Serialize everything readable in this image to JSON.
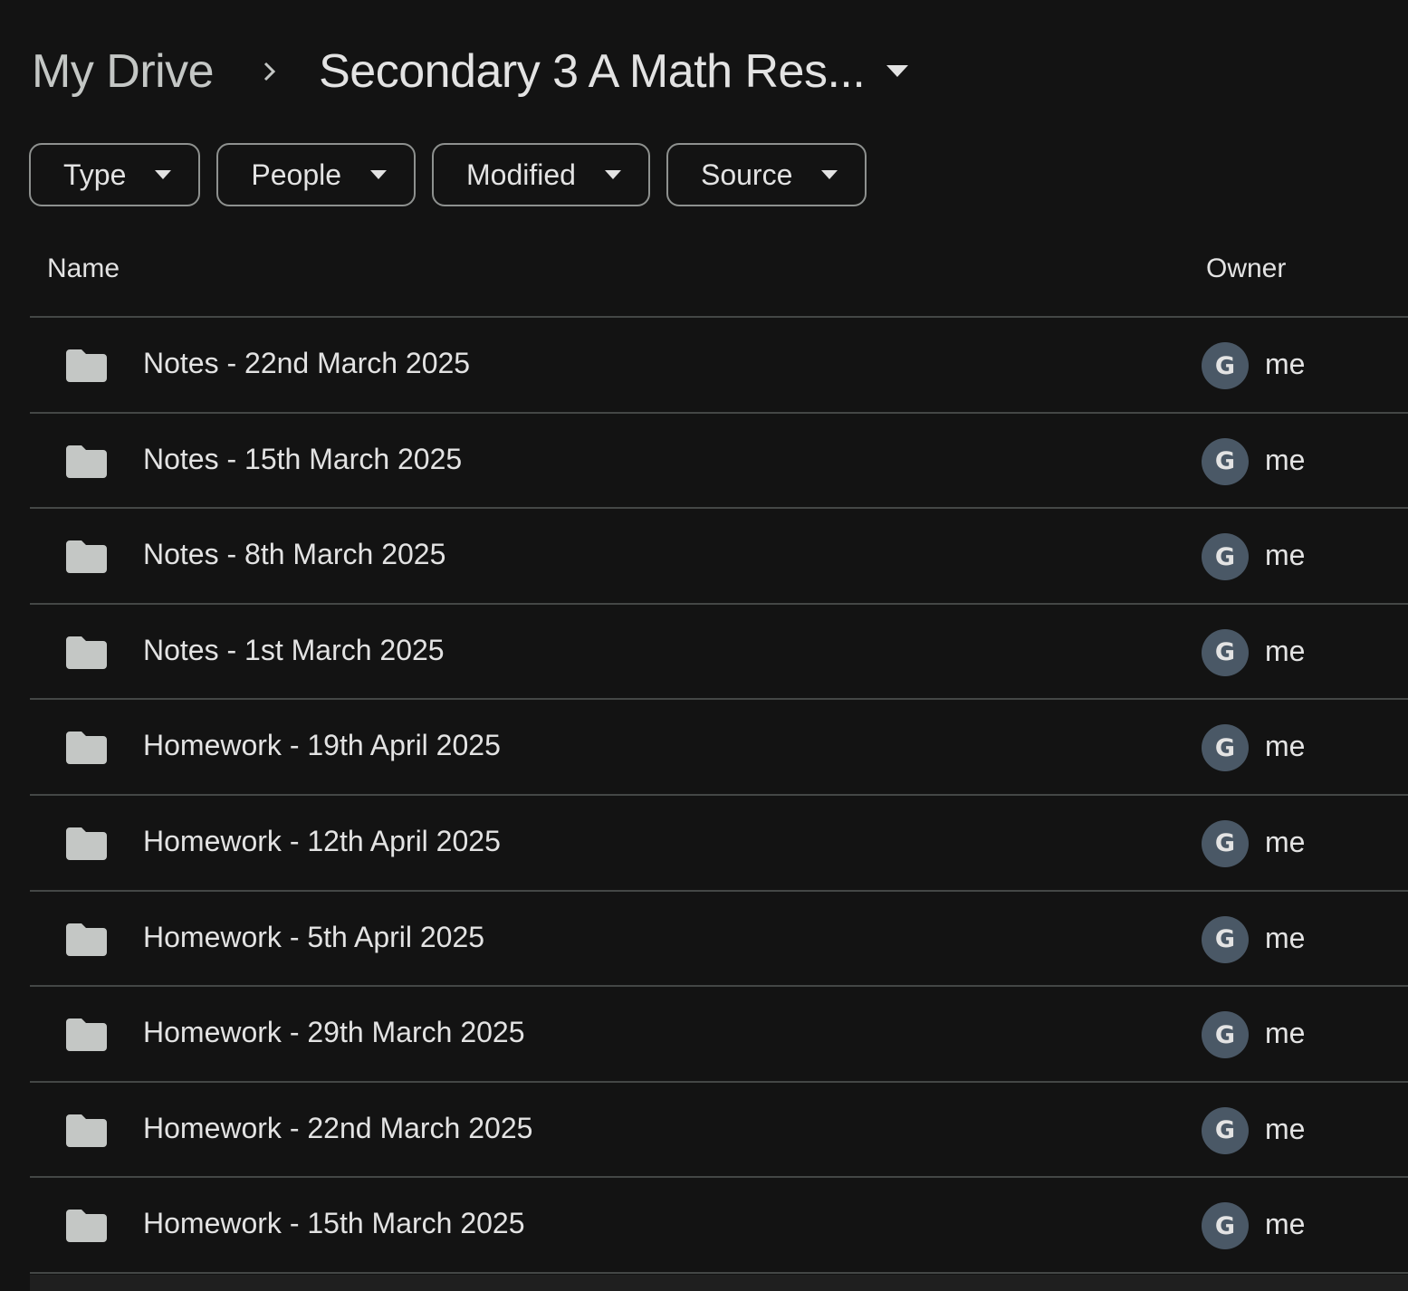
{
  "breadcrumb": {
    "root_label": "My Drive",
    "separator_icon": "chevron-right-icon",
    "current_label": "Secondary 3 A Math Res...",
    "current_caret_icon": "caret-down-icon"
  },
  "filters": [
    {
      "label": "Type",
      "icon": "caret-down-icon"
    },
    {
      "label": "People",
      "icon": "caret-down-icon"
    },
    {
      "label": "Modified",
      "icon": "caret-down-icon"
    },
    {
      "label": "Source",
      "icon": "caret-down-icon"
    }
  ],
  "table": {
    "columns": {
      "name": "Name",
      "owner": "Owner"
    },
    "rows": [
      {
        "name": "Notes - 22nd March 2025",
        "icon": "folder-icon",
        "avatar_letter": "G",
        "owner": "me"
      },
      {
        "name": "Notes - 15th March 2025",
        "icon": "folder-icon",
        "avatar_letter": "G",
        "owner": "me"
      },
      {
        "name": "Notes - 8th March 2025",
        "icon": "folder-icon",
        "avatar_letter": "G",
        "owner": "me"
      },
      {
        "name": "Notes - 1st March 2025",
        "icon": "folder-icon",
        "avatar_letter": "G",
        "owner": "me"
      },
      {
        "name": "Homework - 19th April 2025",
        "icon": "folder-icon",
        "avatar_letter": "G",
        "owner": "me"
      },
      {
        "name": "Homework - 12th April 2025",
        "icon": "folder-icon",
        "avatar_letter": "G",
        "owner": "me"
      },
      {
        "name": "Homework - 5th April 2025",
        "icon": "folder-icon",
        "avatar_letter": "G",
        "owner": "me"
      },
      {
        "name": "Homework - 29th March 2025",
        "icon": "folder-icon",
        "avatar_letter": "G",
        "owner": "me"
      },
      {
        "name": "Homework - 22nd March 2025",
        "icon": "folder-icon",
        "avatar_letter": "G",
        "owner": "me"
      },
      {
        "name": "Homework - 15th March 2025",
        "icon": "folder-icon",
        "avatar_letter": "G",
        "owner": "me"
      }
    ]
  },
  "colors": {
    "background": "#131313",
    "text": "#e3e3e3",
    "muted_text": "#c4c7c5",
    "divider": "#444746",
    "chip_border": "#8e918f",
    "folder_icon": "#c4c7c5",
    "avatar_bg": "#4a5866"
  }
}
